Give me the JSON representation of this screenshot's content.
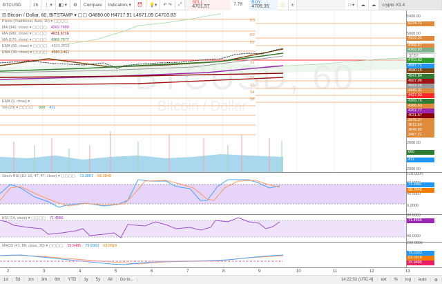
{
  "toolbar": {
    "symbol": "BTCUSD",
    "interval": "1h",
    "compare": "Compare",
    "indicators": "Indicators",
    "sell_label": "SELL",
    "sell_price": "4701.57",
    "spread": "7.78",
    "buy_label": "BUY",
    "buy_price": "4709.35",
    "account": "crypto X3.4"
  },
  "legend": {
    "title": "Bitcoin / Dollar, 60, BITSTAMP",
    "o": "O4680.00",
    "h": "H4717.91",
    "l": "L4671.09",
    "c": "C4703.83",
    "studies": [
      {
        "name": "Pivots (Traditional, Auto, 15)",
        "value": "",
        "color": "#888"
      },
      {
        "name": "MA (340, close)",
        "value": "4262.7689",
        "color": "#9c27b0"
      },
      {
        "name": "MA (680, close)",
        "value": "4031.6716",
        "color": "#8b0000"
      },
      {
        "name": "MA (170, close)",
        "value": "4369.7577",
        "color": "#2e7d32"
      },
      {
        "name": "EMA (68, close)",
        "value": "4503.2619",
        "color": "#888"
      },
      {
        "name": "EMA (30, close)",
        "value": "4580.1461",
        "color": "#7b4a12"
      }
    ],
    "ema9": "EMA (9, close)",
    "vol": "Vol (20)",
    "vol_a": "660",
    "vol_b": "411"
  },
  "pivots": [
    "R3",
    "R2",
    "R1",
    "P",
    "S1",
    "S2",
    "S3",
    "S4",
    "S5"
  ],
  "watermark": {
    "symbol": "BTCUSD, 60",
    "name": "Bitcoin / Dollar"
  },
  "price_axis": {
    "grid": [
      "5400.00",
      "5000.00",
      "2600.00",
      "2000.00"
    ],
    "labels": [
      {
        "v": "5234.71",
        "c": "#e08a3c"
      },
      {
        "v": "4923.35",
        "c": "#e08a3c"
      },
      {
        "v": "4768.67",
        "c": "#e08a3c"
      },
      {
        "v": "4703.83",
        "c": "#7fb08a"
      },
      {
        "v": "37:57",
        "c": "#ffffff"
      },
      {
        "v": "4703.83",
        "c": "#2e9e2e"
      },
      {
        "v": "4587.71",
        "c": "#2196f3"
      },
      {
        "v": "4580.15",
        "c": "#7b4a12"
      },
      {
        "v": "4547.84",
        "c": "#2e7d32"
      },
      {
        "v": "4507.96",
        "c": "#a31515"
      },
      {
        "v": "4503.26",
        "c": "#999999"
      },
      {
        "v": "4449.31",
        "c": "#e08a3c"
      },
      {
        "v": "4427.93",
        "c": "#ff2a2a"
      },
      {
        "v": "4369.76",
        "c": "#2e7d32"
      },
      {
        "v": "4286.63",
        "c": "#e08a3c"
      },
      {
        "v": "4262.77",
        "c": "#9c27b0"
      },
      {
        "v": "4031.67",
        "c": "#8b0000"
      },
      {
        "v": "3975.27",
        "c": "#e08a3c"
      },
      {
        "v": "3812.59",
        "c": "#e08a3c"
      },
      {
        "v": "3649.90",
        "c": "#e08a3c"
      },
      {
        "v": "3487.21",
        "c": "#e08a3c"
      },
      {
        "v": "660",
        "c": "#2e7d32"
      },
      {
        "v": "411",
        "c": "#2196f3"
      }
    ]
  },
  "stoch": {
    "title": "Stoch RSI (10, 10, 47, 47, close)",
    "k": "73.3861",
    "d": "68.3848",
    "axis": [
      "120.0000",
      "80.0000",
      "40.0000",
      "0.0000"
    ]
  },
  "rsi": {
    "title": "RSI (14, close)",
    "value": "71.4556",
    "axis": [
      "80.0000",
      "40.0000"
    ]
  },
  "macd": {
    "title": "MACD (41, 88, close, 30)",
    "hist": "15.9485",
    "macd": "79.0303",
    "signal": "63.0818",
    "axis": [
      "200.0000"
    ]
  },
  "time_axis": [
    "2",
    "3",
    "4",
    "5",
    "6",
    "7",
    "8",
    "9",
    "10",
    "11",
    "12",
    "13"
  ],
  "bottom": {
    "ranges": [
      "1d",
      "5d",
      "1m",
      "3m",
      "6m",
      "YTD",
      "1y",
      "5y",
      "All",
      "Go to..."
    ],
    "clock": "14:22:02 (UTC-4)",
    "opts": [
      "ext",
      "%",
      "log",
      "auto"
    ]
  }
}
